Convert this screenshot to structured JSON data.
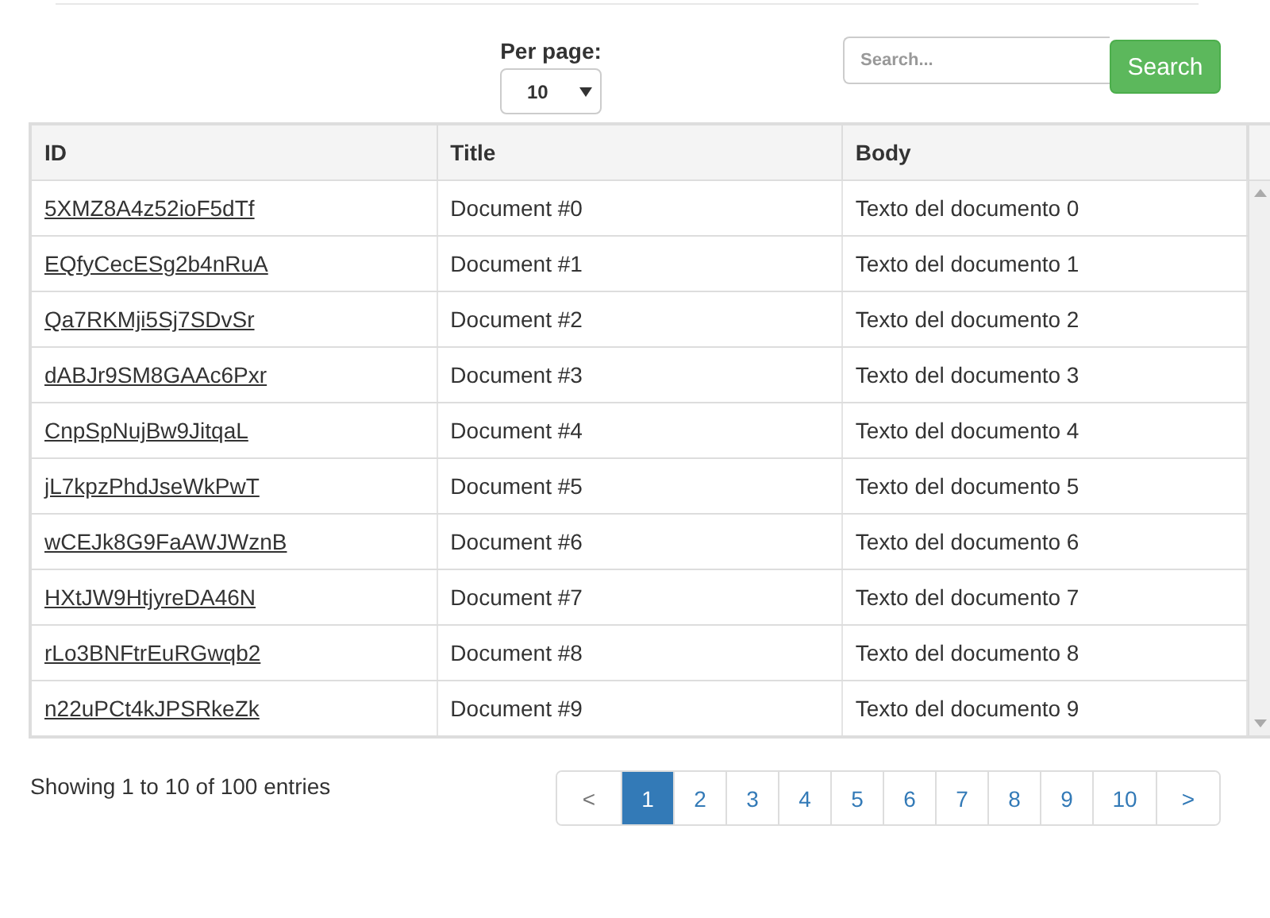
{
  "per_page": {
    "label": "Per page:",
    "value": "10"
  },
  "search": {
    "placeholder": "Search...",
    "button": "Search"
  },
  "table": {
    "columns": [
      "ID",
      "Title",
      "Body"
    ],
    "rows": [
      {
        "id": "5XMZ8A4z52ioF5dTf",
        "title": "Document #0",
        "body": "Texto del documento 0"
      },
      {
        "id": "EQfyCecESg2b4nRuA",
        "title": "Document #1",
        "body": "Texto del documento 1"
      },
      {
        "id": "Qa7RKMji5Sj7SDvSr",
        "title": "Document #2",
        "body": "Texto del documento 2"
      },
      {
        "id": "dABJr9SM8GAAc6Pxr",
        "title": "Document #3",
        "body": "Texto del documento 3"
      },
      {
        "id": "CnpSpNujBw9JitqaL",
        "title": "Document #4",
        "body": "Texto del documento 4"
      },
      {
        "id": "jL7kpzPhdJseWkPwT",
        "title": "Document #5",
        "body": "Texto del documento 5"
      },
      {
        "id": "wCEJk8G9FaAWJWznB",
        "title": "Document #6",
        "body": "Texto del documento 6"
      },
      {
        "id": "HXtJW9HtjyreDA46N",
        "title": "Document #7",
        "body": "Texto del documento 7"
      },
      {
        "id": "rLo3BNFtrEuRGwqb2",
        "title": "Document #8",
        "body": "Texto del documento 8"
      },
      {
        "id": "n22uPCt4kJPSRkeZk",
        "title": "Document #9",
        "body": "Texto del documento 9"
      }
    ]
  },
  "footer": {
    "summary": "Showing 1 to 10 of 100 entries"
  },
  "pagination": [
    {
      "label": "<",
      "kind": "prev",
      "selected": false
    },
    {
      "label": "1",
      "kind": "page",
      "selected": true
    },
    {
      "label": "2",
      "kind": "page",
      "selected": false
    },
    {
      "label": "3",
      "kind": "page",
      "selected": false
    },
    {
      "label": "4",
      "kind": "page",
      "selected": false
    },
    {
      "label": "5",
      "kind": "page",
      "selected": false
    },
    {
      "label": "6",
      "kind": "page",
      "selected": false
    },
    {
      "label": "7",
      "kind": "page",
      "selected": false
    },
    {
      "label": "8",
      "kind": "page",
      "selected": false
    },
    {
      "label": "9",
      "kind": "page",
      "selected": false
    },
    {
      "label": "10",
      "kind": "page",
      "selected": false
    },
    {
      "label": ">",
      "kind": "next",
      "selected": false
    }
  ]
}
